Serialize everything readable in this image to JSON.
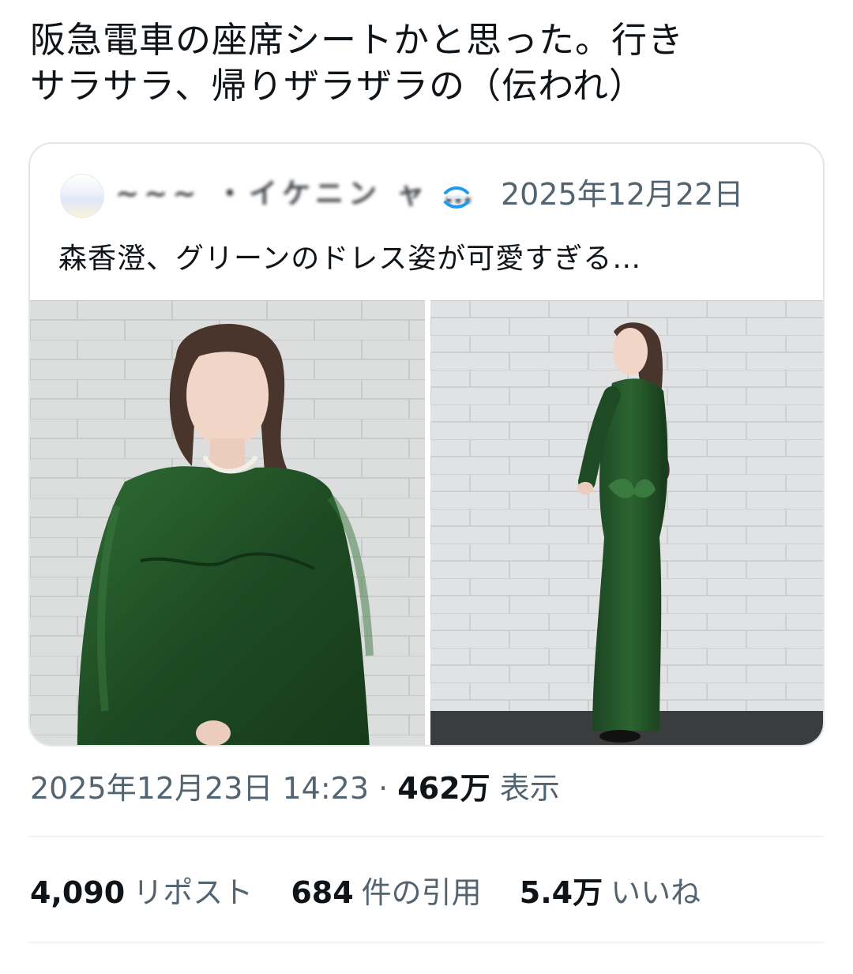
{
  "tweet": {
    "text_line1": "阪急電車の座席シートかと思った。行き",
    "text_line2": "サラサラ、帰りザラザラの（伝われ）"
  },
  "quote": {
    "author_name": "~~~ ・イケニン ャ …",
    "date": "2025年12月22日",
    "text": "森香澄、グリーンのドレス姿が可愛すぎる…"
  },
  "meta": {
    "timestamp": "2025年12月23日 14:23",
    "separator": "·",
    "views_count": "462万",
    "views_label": "表示"
  },
  "stats": {
    "reposts_count": "4,090",
    "reposts_label": "リポスト",
    "quotes_count": "684",
    "quotes_label": "件の引用",
    "likes_count": "5.4万",
    "likes_label": "いいね"
  },
  "colors": {
    "text_primary": "#0f1419",
    "text_secondary": "#536471",
    "border": "#e1e6ea",
    "dress_green": "#1f4d24",
    "wall": "#d9dadb"
  },
  "icons": {
    "verified": "verified-badge-icon"
  }
}
